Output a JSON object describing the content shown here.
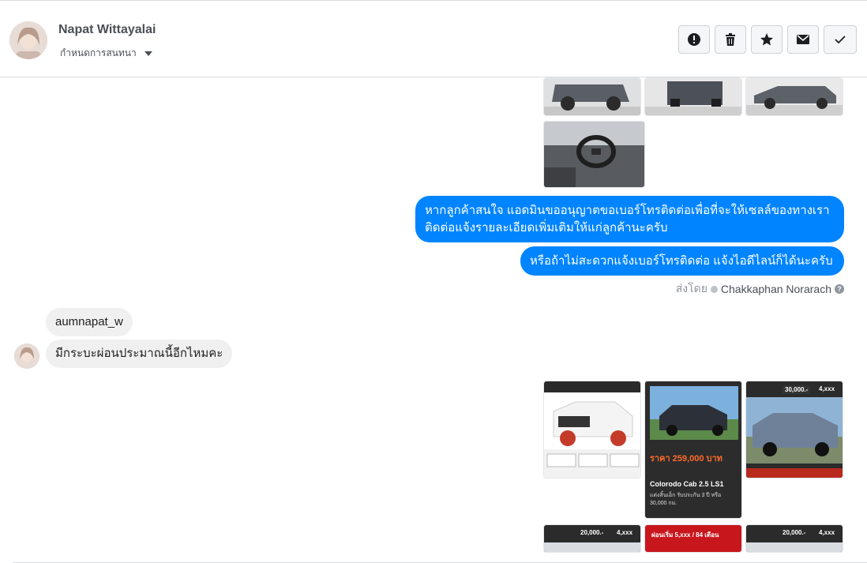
{
  "contact": {
    "name": "Napat Wittayalai",
    "assign_label": "กำหนดการสนทนา"
  },
  "actions": [
    {
      "icon": "alert-icon"
    },
    {
      "icon": "trash-icon"
    },
    {
      "icon": "star-icon"
    },
    {
      "icon": "envelope-icon"
    },
    {
      "icon": "check-icon"
    }
  ],
  "messages": {
    "out1": "หากลูกค้าสนใจ แอดมินขออนุญาตขอเบอร์โทรติดต่อเพื่อที่จะให้เซลล์ของทางเรา ติดต่อแจ้งรายละเอียดเพิ่มเติมให้แก่ลูกค้านะครับ",
    "out2": "หรือถ้าไม่สะดวกแจ้งเบอร์โทรติดต่อ แจ้งไอดีไลน์ก็ได้นะครับ",
    "sent_by_prefix": "ส่งโดย",
    "sent_by_agent": "Chakkaphan Norarach",
    "in1": "aumnapat_w",
    "in2": "มีกระบะผ่อนประมาณนี้อีกไหมคะ"
  },
  "cards": {
    "card2_price": "ราคา 259,000 บาท",
    "card2_model": "Colorodo Cab 2.5 LS1",
    "card2_line1": "แต่งสิ้นเอ็ก รับประกัน 3 ปี หรือ",
    "card2_line2": "30,000 กม.",
    "card3_price": "30,000.-",
    "card3_badge": "4,xxx",
    "card4_price": "20,000.-",
    "card4_badge": "4,xxx",
    "card5_banner": "ผ่อนเริ่ม 5,xxx / 84 เดือน",
    "card6_price": "20,000.-",
    "card6_badge": "4,xxx"
  },
  "colors": {
    "outgoing_bubble": "#0084ff",
    "incoming_bubble": "#f1f0f0",
    "border": "#dadde1"
  }
}
